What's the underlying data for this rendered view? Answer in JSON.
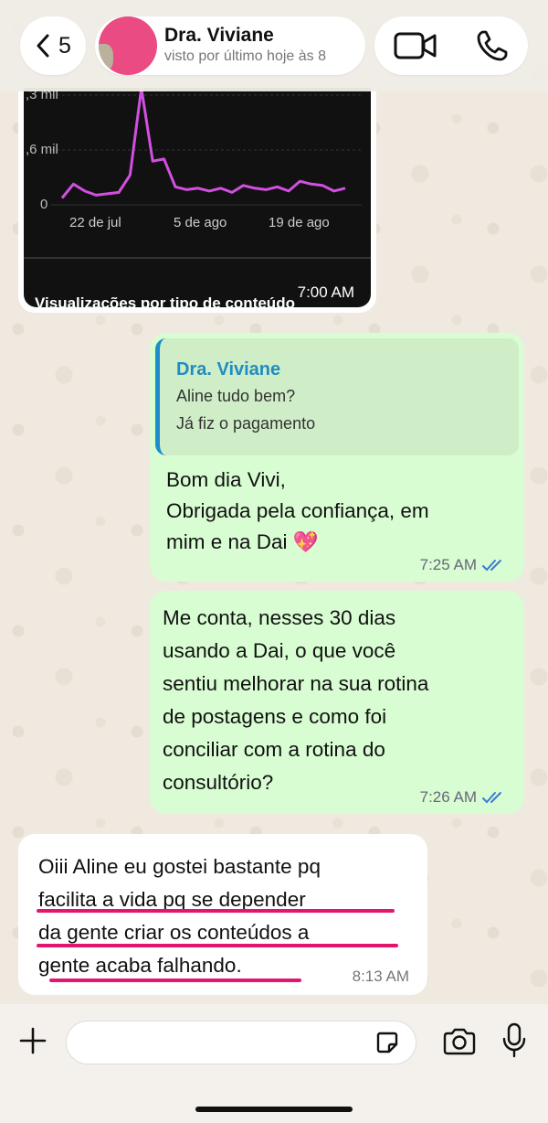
{
  "header": {
    "back_count": "5",
    "contact_name": "Dra. Viviane",
    "contact_status": "visto por último hoje às 8"
  },
  "image_message": {
    "y_tick_top": ",3 mil",
    "y_tick_mid": ",6 mil",
    "y_tick_zero": "0",
    "x_ticks": [
      "22 de jul",
      "5 de ago",
      "19 de ago"
    ],
    "caption_cut": "Visualizações por tipo de conteúdo",
    "time": "7:00 AM",
    "line_color": "#d24fe0",
    "series_values": [
      0.02,
      0.22,
      0.12,
      0.06,
      0.08,
      0.1,
      0.35,
      1.6,
      0.55,
      0.58,
      0.18,
      0.14,
      0.16,
      0.12,
      0.16,
      0.1,
      0.2,
      0.16,
      0.14,
      0.18,
      0.12,
      0.26,
      0.22,
      0.2,
      0.12,
      0.16
    ]
  },
  "messages": {
    "reply": {
      "quote_name": "Dra. Viviane",
      "quote_line1": "Aline tudo bem?",
      "quote_line2": "Já fiz o pagamento",
      "line1": "Bom dia Vivi,",
      "line2": "Obrigada pela confiança, em",
      "line3": "mim e na Dai 💖",
      "time": "7:25 AM"
    },
    "question": {
      "line1": "Me conta, nesses 30 dias",
      "line2": "usando a Dai, o que você",
      "line3": "sentiu melhorar na sua rotina",
      "line4": "de postagens e como foi",
      "line5": "conciliar com a rotina do",
      "line6": "consultório?",
      "time": "7:26 AM"
    },
    "answer": {
      "line1": "Oiii Aline eu gostei bastante pq",
      "line2": "facilita a vida pq se depender",
      "line3": "da gente criar os conteúdos a",
      "line4": "gente acaba falhando.",
      "time": "8:13 AM"
    }
  },
  "composer": {
    "placeholder": ""
  },
  "colors": {
    "outgoing_bubble": "#d9fdd3",
    "incoming_bubble": "#ffffff",
    "read_ticks": "#3a7bd5",
    "highlight_underline": "#e2166e"
  }
}
